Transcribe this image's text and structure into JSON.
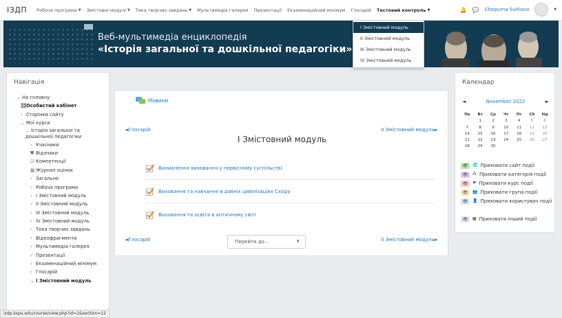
{
  "topnav": {
    "brand": "ІЗДП",
    "menu": [
      {
        "label": "Робоча програма",
        "has_caret": true
      },
      {
        "label": "Змістовні модулі",
        "has_caret": true
      },
      {
        "label": "Тека творчих завдань",
        "has_caret": true
      },
      {
        "label": "Мультимедіа галерея",
        "has_caret": false
      },
      {
        "label": "Презентації",
        "has_caret": false
      },
      {
        "label": "Екзаменаційний мінімум",
        "has_caret": false
      },
      {
        "label": "Глосарій",
        "has_caret": false
      },
      {
        "label": "Тестовий контроль",
        "has_caret": true
      }
    ],
    "user_name": "Chepurna Svitlana"
  },
  "banner": {
    "title_line1": "Веб-мультимедіа енциклопедія",
    "title_line2": "«Історія загальної та дошкільної педагогіки»"
  },
  "dropdown": {
    "items": [
      {
        "label": "І Змістовний модуль",
        "active": true
      },
      {
        "label": "ІІ Змістовний модуль",
        "active": false
      },
      {
        "label": "ІІІ Змістовний модуль",
        "active": false
      },
      {
        "label": "IV Змістовний модуль",
        "active": false
      }
    ]
  },
  "navigation": {
    "title": "Навігація",
    "items": [
      {
        "label": "На головну",
        "marker": "⌄",
        "indent": 0
      },
      {
        "label": "Особистий кабінет",
        "marker": "🎛",
        "indent": 1,
        "bold": true
      },
      {
        "label": "Сторінки сайту",
        "marker": "›",
        "indent": 1
      },
      {
        "label": "Мої курси",
        "marker": "⌄",
        "indent": 1
      },
      {
        "label": "Історія загальної та дошкільної педагогіки",
        "marker": "⌄",
        "indent": 2,
        "wrap": true
      },
      {
        "label": "Учасники",
        "marker": "›",
        "indent": 3
      },
      {
        "label": "Відзнаки",
        "marker": "⛊",
        "indent": 3
      },
      {
        "label": "Компетенції",
        "marker": "☑",
        "indent": 3
      },
      {
        "label": "Журнал оцінок",
        "marker": "▦",
        "indent": 3
      },
      {
        "label": "Загальне",
        "marker": "›",
        "indent": 3
      },
      {
        "label": "Робоча програма",
        "marker": "›",
        "indent": 3
      },
      {
        "label": "І Змістовний модуль",
        "marker": "›",
        "indent": 3
      },
      {
        "label": "ІІ Змістовний модуль",
        "marker": "›",
        "indent": 3
      },
      {
        "label": "ІІІ Змістовний модуль",
        "marker": "›",
        "indent": 3
      },
      {
        "label": "IV Змістовний модуль",
        "marker": "›",
        "indent": 3
      },
      {
        "label": "Тека творчих завдань",
        "marker": "›",
        "indent": 3
      },
      {
        "label": "Відеофрагменти",
        "marker": "›",
        "indent": 3
      },
      {
        "label": "Мультимедіа галерея",
        "marker": "›",
        "indent": 3
      },
      {
        "label": "Презентації",
        "marker": "›",
        "indent": 3
      },
      {
        "label": "Екзаменаційний мінімум",
        "marker": "›",
        "indent": 3
      },
      {
        "label": "Глосарій",
        "marker": "›",
        "indent": 3
      },
      {
        "label": "І Змістовний модуль",
        "marker": "⌄",
        "indent": 3,
        "bold": true
      }
    ]
  },
  "content": {
    "news": "Новини",
    "prev_link": "◄Глосарій",
    "next_link": "ІІ Змістовний модуль►",
    "section_title": "І Змістовний модуль",
    "activities": [
      "Виникнення виховання у первісному суспільстві",
      "Виховання та навчання в давніх цивілізаціях Сходу",
      "Виховання та освіта в античному світі"
    ],
    "jump_placeholder": "Перейти до..."
  },
  "calendar": {
    "title": "Календар",
    "prev": "◄",
    "next": "►",
    "month": "November 2022",
    "weekdays": [
      "Пн",
      "Вт",
      "Ср",
      "Чт",
      "Пт",
      "Сб",
      "Нд"
    ],
    "weeks": [
      [
        "",
        "1",
        "2",
        "3",
        "4",
        "5",
        "6"
      ],
      [
        "7",
        "8",
        "9",
        "10",
        "11",
        "12",
        "13"
      ],
      [
        "14",
        "15",
        "16",
        "17",
        "18",
        "19",
        "20"
      ],
      [
        "21",
        "22",
        "23",
        "24",
        "25",
        "26",
        "27"
      ],
      [
        "28",
        "29",
        "30",
        "",
        "",
        "",
        ""
      ]
    ],
    "filters": [
      {
        "label": "Приховати сайт події",
        "icon": "🌐",
        "color": "#b6e3b6"
      },
      {
        "label": "Приховати категорія події",
        "icon": "⁂",
        "color": "#d9c9f0"
      },
      {
        "label": "Приховати курс події",
        "icon": "⚑",
        "color": "#f9c9c9"
      },
      {
        "label": "Приховати група події",
        "icon": "👥",
        "color": "#fde6b3"
      },
      {
        "label": "Приховати користувач події",
        "icon": "👤",
        "color": "#d6e4f1"
      },
      {
        "label": "Приховати інший події",
        "icon": "▦",
        "color": "#d6e4f1"
      }
    ]
  },
  "statusbar": {
    "url": "izdp.kspu.edu/course/view.php?id=2&section=12"
  },
  "colors": {
    "banner": "#133b52",
    "link": "#1b75bb",
    "accent": "#133b52"
  }
}
